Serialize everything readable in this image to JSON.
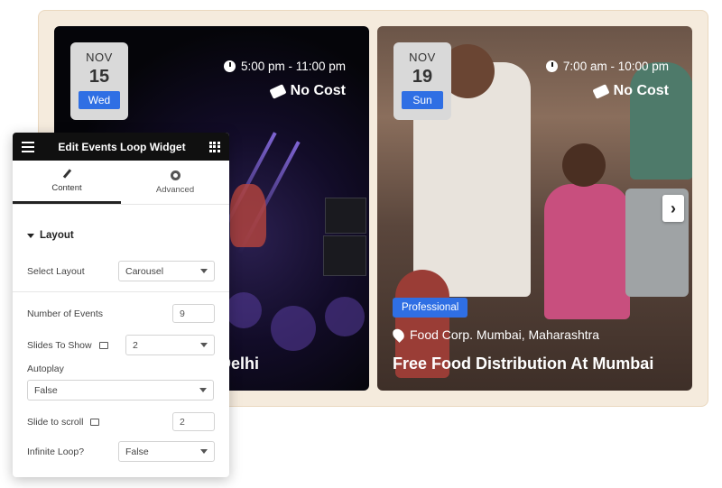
{
  "events": [
    {
      "month": "NOV",
      "day": "15",
      "weekday": "Wed",
      "time": "5:00 pm - 11:00 pm",
      "cost": "No Cost",
      "title_fragment": "Delhi"
    },
    {
      "month": "NOV",
      "day": "19",
      "weekday": "Sun",
      "time": "7:00 am - 10:00 pm",
      "cost": "No Cost",
      "category": "Professional",
      "location": "Food Corp. Mumbai, Maharashtra",
      "title": "Free Food Distribution At Mumbai"
    }
  ],
  "carousel": {
    "next_icon": "chevron-right-icon"
  },
  "panel": {
    "title": "Edit Events Loop Widget",
    "tabs": [
      {
        "label": "Content",
        "icon": "pencil-icon",
        "active": true
      },
      {
        "label": "Advanced",
        "icon": "gear-icon",
        "active": false
      }
    ],
    "section_title": "Layout",
    "fields": {
      "select_layout": {
        "label": "Select Layout",
        "value": "Carousel"
      },
      "number_of_events": {
        "label": "Number of Events",
        "value": "9"
      },
      "slides_to_show": {
        "label": "Slides To Show",
        "value": "2"
      },
      "autoplay": {
        "label": "Autoplay",
        "value": "False"
      },
      "slide_to_scroll": {
        "label": "Slide to scroll",
        "value": "2"
      },
      "infinite_loop": {
        "label": "Infinite Loop?",
        "value": "False"
      }
    }
  },
  "colors": {
    "accent": "#2f6fe4",
    "frame": "#f5ebdd",
    "panel_header": "#101010"
  }
}
